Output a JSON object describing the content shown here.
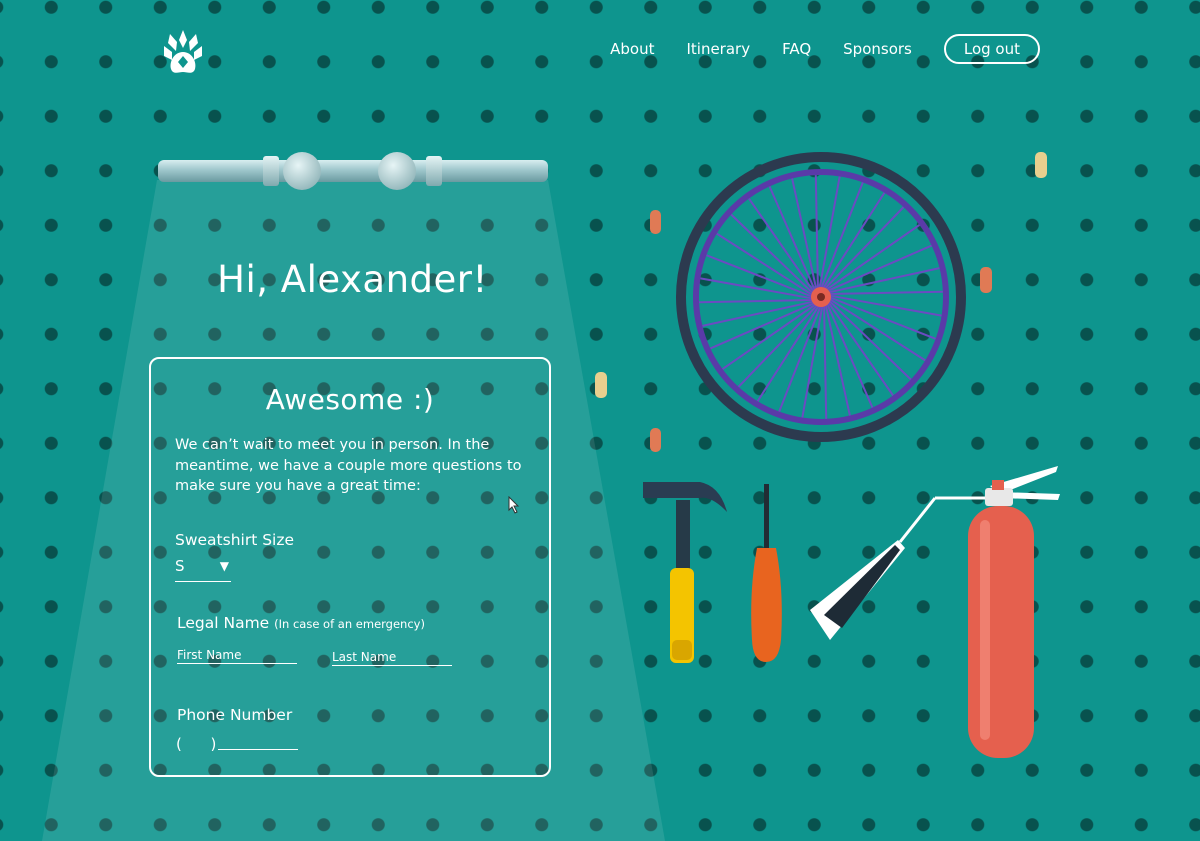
{
  "nav": {
    "logo_icon": "paw-icon",
    "links": [
      "About",
      "Itinerary",
      "FAQ",
      "Sponsors"
    ],
    "logout_label": "Log out"
  },
  "greeting": "Hi, Alexander!",
  "form": {
    "title": "Awesome :)",
    "intro": "We can’t wait to meet you in person. In the meantime, we have a couple more questions to make sure you have a great time:",
    "sweatshirt": {
      "label": "Sweatshirt Size",
      "selected": "S"
    },
    "legal_name": {
      "label": "Legal Name",
      "note": "(In case of an emergency)",
      "first_placeholder": "First Name",
      "last_placeholder": "Last Name"
    },
    "phone": {
      "label": "Phone Number",
      "prefix": "(      )"
    }
  },
  "colors": {
    "background": "#0e958e",
    "peg_holes": "#08524e",
    "wheel_rim": "#3a2a6a",
    "extinguisher": "#e5604e",
    "hammer_handle": "#f4c400",
    "screwdriver_handle": "#e8641f"
  },
  "decor": {
    "tools": [
      "bicycle-wheel",
      "hammer",
      "screwdriver",
      "fire-extinguisher",
      "pegs",
      "light-pipe"
    ]
  }
}
